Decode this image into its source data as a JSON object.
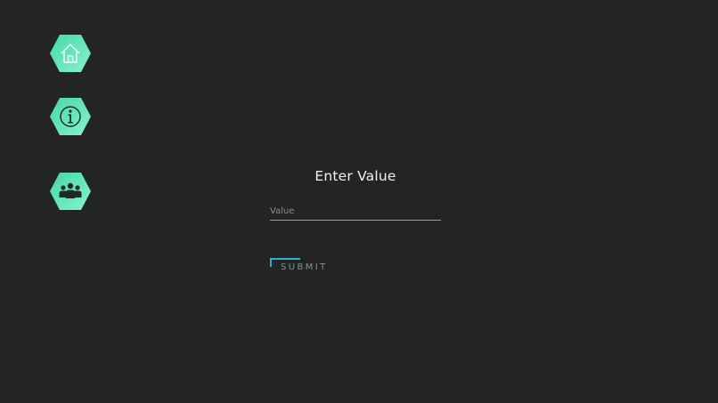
{
  "nav": {
    "items": [
      {
        "name": "home",
        "icon": "home-icon"
      },
      {
        "name": "info",
        "icon": "info-icon"
      },
      {
        "name": "team",
        "icon": "group-icon"
      }
    ],
    "hex_gradient": [
      "#4fe0a8",
      "#7ff0c8"
    ]
  },
  "form": {
    "title": "Enter Value",
    "input_placeholder": "Value",
    "submit_label": "SUBMIT",
    "accent_color": "#2fb3c6"
  }
}
